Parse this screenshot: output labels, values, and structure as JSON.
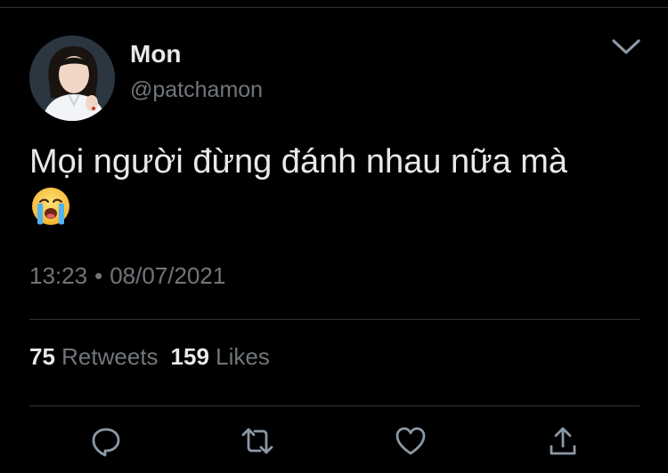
{
  "tweet": {
    "author_name": "Mon",
    "author_handle": "@patchamon",
    "text": "Mọi người đừng đánh nhau nữa mà",
    "emoji_icon": "loudly-crying-face",
    "time": "13:23",
    "separator": "•",
    "date": "08/07/2021"
  },
  "stats": {
    "retweets_count": "75",
    "retweets_label": "Retweets",
    "likes_count": "159",
    "likes_label": "Likes"
  },
  "actions": {
    "icons": [
      "reply-icon",
      "retweet-icon",
      "like-icon",
      "share-icon"
    ]
  },
  "colors": {
    "background": "#000000",
    "text_primary": "#e7e9ea",
    "text_secondary": "#71767b",
    "divider": "#2f3336"
  }
}
